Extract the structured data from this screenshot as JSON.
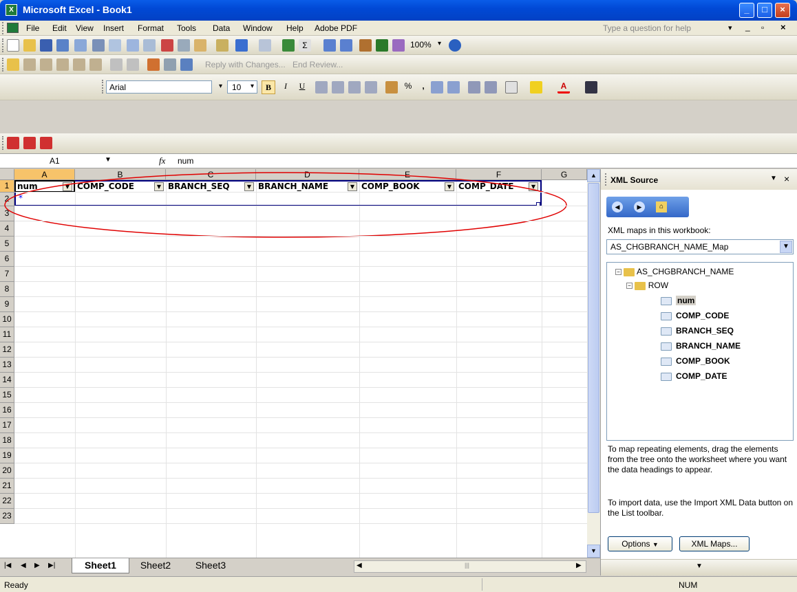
{
  "window": {
    "title": "Microsoft Excel - Book1"
  },
  "menu": {
    "items": [
      "File",
      "Edit",
      "View",
      "Insert",
      "Format",
      "Tools",
      "Data",
      "Window",
      "Help",
      "Adobe PDF"
    ],
    "help_placeholder": "Type a question for help"
  },
  "toolbar": {
    "zoom": "100%",
    "font": "Arial",
    "size": "10",
    "reply_label": "Reply with Changes...",
    "end_review_label": "End Review..."
  },
  "formula": {
    "cell_ref": "A1",
    "fx": "fx",
    "value": "num"
  },
  "grid": {
    "columns": [
      "A",
      "B",
      "C",
      "D",
      "E",
      "F",
      "G"
    ],
    "rows": [
      "1",
      "2",
      "3",
      "4",
      "5",
      "6",
      "7",
      "8",
      "9",
      "10",
      "11",
      "12",
      "13",
      "14",
      "15",
      "16",
      "17",
      "18",
      "19",
      "20",
      "21",
      "22",
      "23"
    ],
    "headers": [
      "num",
      "COMP_CODE",
      "BRANCH_SEQ",
      "BRANCH_NAME",
      "COMP_BOOK",
      "COMP_DATE"
    ],
    "insert_marker": "*"
  },
  "sheets": {
    "tabs": [
      "Sheet1",
      "Sheet2",
      "Sheet3"
    ],
    "active": "Sheet1"
  },
  "status": {
    "left": "Ready",
    "num": "NUM"
  },
  "xml_pane": {
    "title": "XML Source",
    "maps_label": "XML maps in this workbook:",
    "selected_map": "AS_CHGBRANCH_NAME_Map",
    "tree": {
      "root": "AS_CHGBRANCH_NAME",
      "row": "ROW",
      "fields": [
        "num",
        "COMP_CODE",
        "BRANCH_SEQ",
        "BRANCH_NAME",
        "COMP_BOOK",
        "COMP_DATE"
      ]
    },
    "hint1": "To map repeating elements, drag the elements from the tree onto the worksheet where you want the data headings to appear.",
    "hint2": "To import data, use the Import XML Data button on the List toolbar.",
    "options_label": "Options",
    "xml_maps_label": "XML Maps..."
  },
  "colors": {
    "title_blue": "#0149d6",
    "list_border": "#000080",
    "annotation": "#e00000",
    "selected_header": "#f7c36a"
  }
}
